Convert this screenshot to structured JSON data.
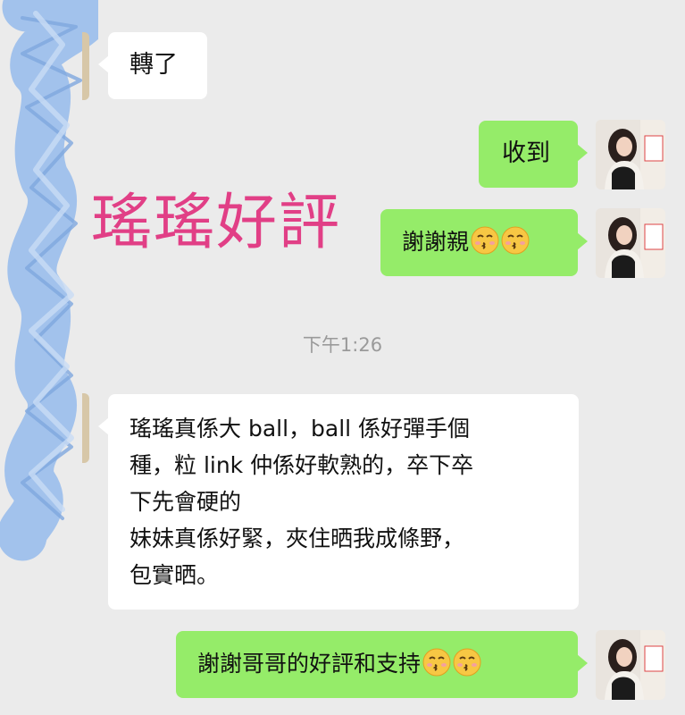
{
  "chat": {
    "messages": [
      {
        "side": "in",
        "text": "轉了"
      },
      {
        "side": "out",
        "text": "收到"
      },
      {
        "side": "out",
        "text": "謝謝親",
        "emojis": [
          "kissing-face",
          "kissing-face"
        ]
      },
      {
        "side": "in",
        "lines": [
          "瑤瑤真係大 ball，ball 係好彈手個",
          "種，粒 link 仲係好軟熟的，卒下卒",
          "下先會硬的",
          "妹妹真係好緊，夾住晒我成條野，",
          "包實晒。"
        ]
      },
      {
        "side": "out",
        "text": "謝謝哥哥的好評和支持",
        "emojis": [
          "kissing-face",
          "kissing-face"
        ]
      }
    ],
    "timestamp": "下午1:26"
  },
  "overlay": {
    "text": "瑤瑤好評",
    "color": "#e13f86"
  },
  "colors": {
    "background": "#ebebeb",
    "incoming_bubble": "#ffffff",
    "outgoing_bubble": "#95ec69",
    "scribble": "#9ec0ec"
  },
  "icons": {
    "avatar_left": "redacted-avatar",
    "avatar_right": "user-photo-avatar",
    "emoji": "kissing-face"
  }
}
